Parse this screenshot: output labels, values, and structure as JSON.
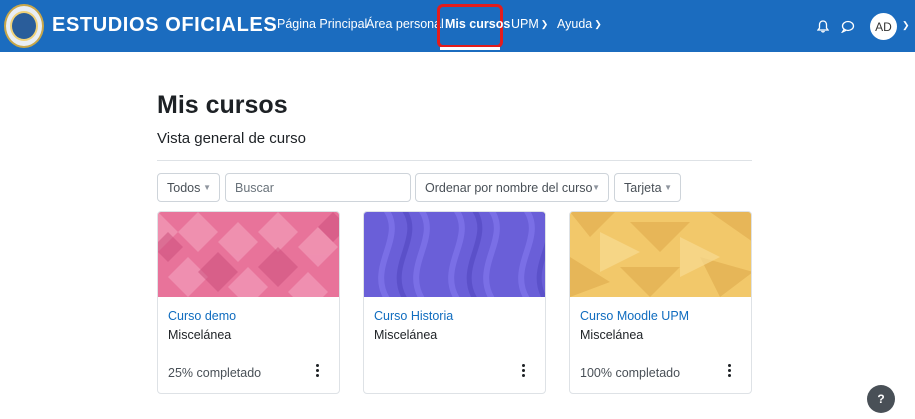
{
  "header": {
    "brand": "ESTUDIOS OFICIALES",
    "nav": [
      {
        "label": "Página Principal"
      },
      {
        "label": "Área personal"
      },
      {
        "label": "Mis cursos"
      },
      {
        "label": "UPM"
      },
      {
        "label": "Ayuda"
      }
    ],
    "avatar_initials": "AD",
    "icons": [
      "bell-icon",
      "chat-icon",
      "chevron-down-icon"
    ],
    "bar_color": "#1b6cbf",
    "highlight_color": "#e31c1c"
  },
  "main": {
    "title": "Mis cursos",
    "subtitle": "Vista general de curso",
    "filters": {
      "grouping": "Todos",
      "search_placeholder": "Buscar",
      "sort": "Ordenar por nombre del curso",
      "view": "Tarjeta"
    },
    "courses": [
      {
        "name": "Curso demo",
        "category": "Miscelánea",
        "progress_text": "25% completado",
        "progress": 25,
        "image_color": "#e8739a"
      },
      {
        "name": "Curso Historia",
        "category": "Miscelánea",
        "progress_text": "",
        "progress": null,
        "image_color": "#6a5fd8"
      },
      {
        "name": "Curso Moodle UPM",
        "category": "Miscelánea",
        "progress_text": "100% completado",
        "progress": 100,
        "image_color": "#f2c86a"
      }
    ]
  },
  "help_button": "?"
}
